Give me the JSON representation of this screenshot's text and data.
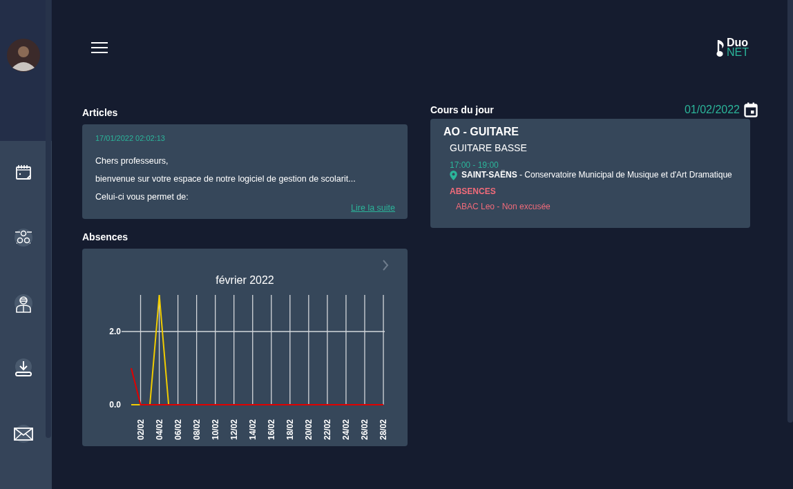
{
  "logo": {
    "word_top": "Duo",
    "word_bottom": "NET"
  },
  "sidebar": {
    "items": [
      {
        "kind": "calendar"
      },
      {
        "kind": "network"
      },
      {
        "kind": "teacher"
      },
      {
        "kind": "download"
      },
      {
        "kind": "mail"
      }
    ]
  },
  "articles": {
    "title": "Articles",
    "items": [
      {
        "date": "17/01/2022 02:02:13",
        "lines": [
          "Chers professeurs,",
          "bienvenue sur votre espace de notre logiciel de gestion de scolarit...",
          "Celui-ci vous permet de:"
        ],
        "link": "Lire la suite"
      }
    ]
  },
  "absences": {
    "title": "Absences",
    "chart_data": {
      "type": "line",
      "title": "février 2022",
      "categories": [
        null,
        "02/02",
        null,
        "04/02",
        null,
        "06/02",
        null,
        "08/02",
        null,
        "10/02",
        null,
        "12/02",
        null,
        "14/02",
        null,
        "16/02",
        null,
        "18/02",
        null,
        "20/02",
        null,
        "22/02",
        null,
        "24/02",
        null,
        "26/02",
        null,
        "28/02"
      ],
      "series": [
        {
          "color": "#f2cd00",
          "values": [
            0,
            0,
            0,
            3,
            0,
            null,
            null,
            null,
            null,
            null,
            null,
            null,
            null,
            null,
            null,
            null,
            null,
            null,
            null,
            null,
            null,
            null,
            null,
            null,
            null,
            null,
            null,
            null
          ]
        },
        {
          "color": "#e00000",
          "values": [
            1,
            0,
            0,
            0,
            0,
            0,
            0,
            0,
            0,
            0,
            0,
            0,
            0,
            0,
            0,
            0,
            0,
            0,
            0,
            0,
            0,
            0,
            0,
            0,
            0,
            0,
            0,
            0
          ]
        }
      ],
      "ylim": [
        0,
        3
      ],
      "grid": true,
      "yticks": [
        {
          "value": 0,
          "label": "0.0"
        },
        {
          "value": 2,
          "label": "2.0"
        }
      ]
    }
  },
  "courses": {
    "title": "Cours du jour",
    "date": "01/02/2022",
    "items": [
      {
        "title": "AO - GUITARE",
        "subtitle": "GUITARE BASSE",
        "time": "17:00 - 19:00",
        "place": "SAINT-SAËNS",
        "place_detail": " - Conservatoire Municipal de Musique et d'Art Dramatique",
        "absences_title": "ABSENCES",
        "absences": [
          "ABAC Leo - Non excusée"
        ]
      }
    ]
  }
}
